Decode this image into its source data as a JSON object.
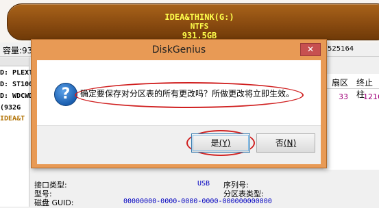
{
  "partition": {
    "label": "IDEA&THINK(G:)",
    "filesystem": "NTFS",
    "size": "931.5GB",
    "color": "#8a4b10",
    "text_color": "#ffff4c"
  },
  "capacity": {
    "label": "容量:93",
    "right_value": "525164"
  },
  "tree": {
    "items": [
      "D: PLEXT",
      "D: ST100",
      "D: WDCWD",
      "(932G",
      "IDEA&T"
    ]
  },
  "table": {
    "headers": [
      "扇区",
      "终止柱"
    ],
    "row": [
      "33",
      "1216"
    ]
  },
  "info": {
    "interface_label": "接口类型:",
    "interface_value": "USB",
    "serial_label": "序列号:",
    "model_label": "型号:",
    "ptype_label": "分区表类型:",
    "guid_label": "磁盘 GUID:",
    "guid_value": "00000000-0000-0000-0000-000000000000"
  },
  "dialog": {
    "title": "DiskGenius",
    "close_icon": "close-icon",
    "message": "确定要保存对分区表的所有更改吗？所做更改将立即生效。",
    "yes_label": "是",
    "yes_hotkey": "(Y)",
    "no_label": "否",
    "no_hotkey": "(N)",
    "accent_color": "#e89a55",
    "highlight_color": "#d02020"
  }
}
